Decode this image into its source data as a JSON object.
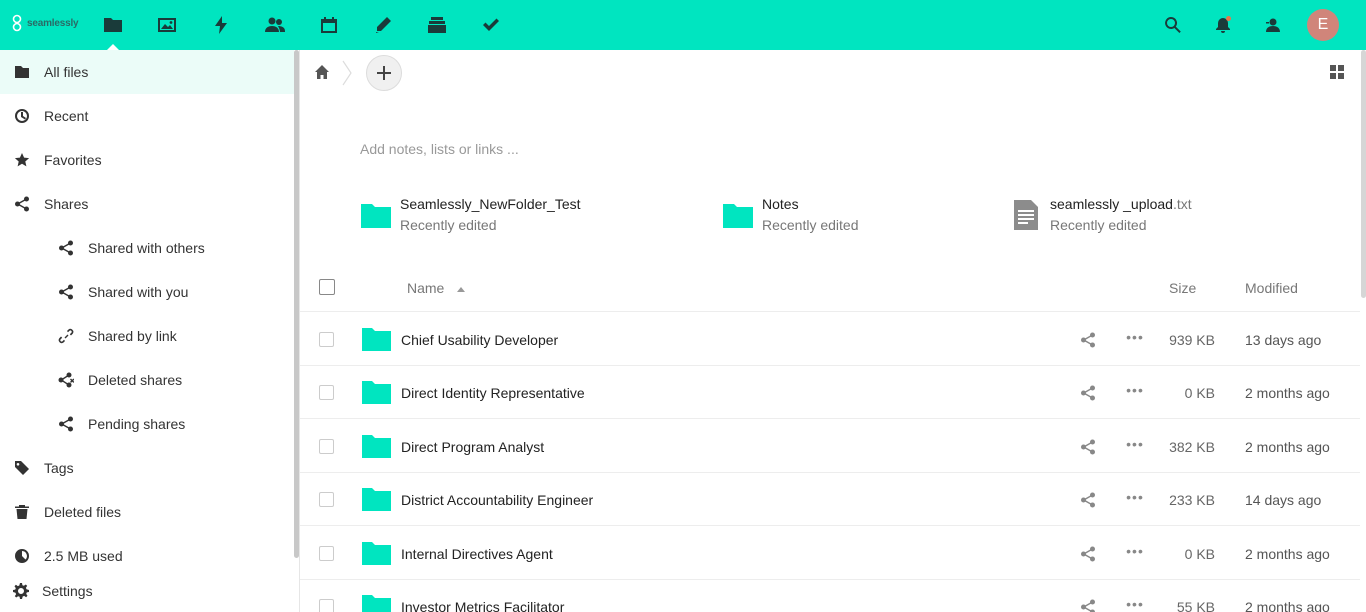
{
  "header": {
    "logo_text": "seamlessly",
    "apps": [
      {
        "name": "files-icon",
        "label": "Files",
        "active": true
      },
      {
        "name": "photos-icon",
        "label": "Photos"
      },
      {
        "name": "activity-icon",
        "label": "Activity"
      },
      {
        "name": "contacts-icon",
        "label": "Contacts"
      },
      {
        "name": "calendar-icon",
        "label": "Calendar"
      },
      {
        "name": "notes-icon",
        "label": "Notes"
      },
      {
        "name": "deck-icon",
        "label": "Deck"
      },
      {
        "name": "tasks-icon",
        "label": "Tasks"
      }
    ],
    "avatar_letter": "E",
    "accent_color": "#00e5c0"
  },
  "sidebar": {
    "items": [
      {
        "label": "All files",
        "icon": "folder-icon"
      },
      {
        "label": "Recent",
        "icon": "clock-icon"
      },
      {
        "label": "Favorites",
        "icon": "star-icon"
      },
      {
        "label": "Shares",
        "icon": "share-icon"
      },
      {
        "label": "Shared with others",
        "icon": "share-icon"
      },
      {
        "label": "Shared with you",
        "icon": "share-icon"
      },
      {
        "label": "Shared by link",
        "icon": "link-icon"
      },
      {
        "label": "Deleted shares",
        "icon": "deleted-share-icon"
      },
      {
        "label": "Pending shares",
        "icon": "share-icon"
      },
      {
        "label": "Tags",
        "icon": "tag-icon"
      },
      {
        "label": "Deleted files",
        "icon": "trash-icon"
      },
      {
        "label": "2.5 MB used",
        "icon": "quota-pie-icon"
      },
      {
        "label": "Settings",
        "icon": "gear-icon"
      }
    ]
  },
  "main": {
    "notes_placeholder": "Add notes, lists or links ...",
    "recent": [
      {
        "name": "Seamlessly_NewFolder_Test",
        "ext": "",
        "sub": "Recently edited",
        "type": "folder"
      },
      {
        "name": "Notes",
        "ext": "",
        "sub": "Recently edited",
        "type": "folder"
      },
      {
        "name": "seamlessly _upload",
        "ext": ".txt",
        "sub": "Recently edited",
        "type": "file"
      }
    ],
    "table": {
      "col_name": "Name",
      "col_size": "Size",
      "col_modified": "Modified",
      "more_glyph": "•••",
      "rows": [
        {
          "name": "Chief Usability Developer",
          "size": "939 KB",
          "modified": "13 days ago"
        },
        {
          "name": "Direct Identity Representative",
          "size": "0 KB",
          "modified": "2 months ago"
        },
        {
          "name": "Direct Program Analyst",
          "size": "382 KB",
          "modified": "2 months ago"
        },
        {
          "name": "District Accountability Engineer",
          "size": "233 KB",
          "modified": "14 days ago"
        },
        {
          "name": "Internal Directives Agent",
          "size": "0 KB",
          "modified": "2 months ago"
        },
        {
          "name": "Investor Metrics Facilitator",
          "size": "55 KB",
          "modified": "2 months ago"
        }
      ]
    }
  }
}
